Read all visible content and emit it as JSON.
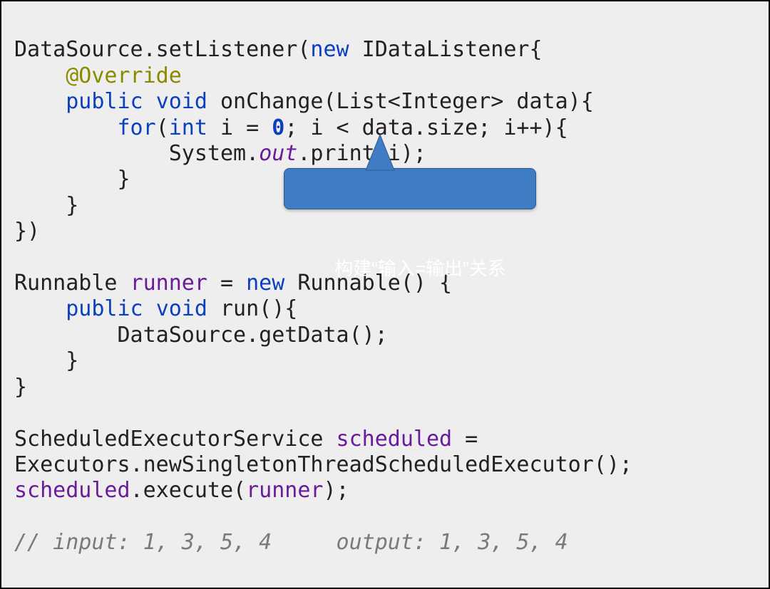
{
  "callout": {
    "text": "构建“输入=输出”关系"
  },
  "code": {
    "l1": {
      "a": "DataSource.setListener(",
      "b": "new",
      "c": " IDataListener{"
    },
    "l2": {
      "indent": "    ",
      "a": "@Override"
    },
    "l3": {
      "indent": "    ",
      "a": "public",
      "sp": " ",
      "b": "void",
      "c": " onChange(List<Integer> data){"
    },
    "l4": {
      "indent": "        ",
      "a": "for",
      "b": "(",
      "c": "int",
      "d": " i = ",
      "e": "0",
      "f": "; i < data.size; i++){"
    },
    "l5": {
      "indent": "            ",
      "a": "System.",
      "b": "out",
      "c": ".print(i);"
    },
    "l6": {
      "indent": "        ",
      "a": "}"
    },
    "l7": {
      "indent": "    ",
      "a": "}"
    },
    "l8": {
      "a": "})"
    },
    "blank1": "",
    "l9": {
      "a": "Runnable ",
      "b": "runner",
      "c": " = ",
      "d": "new",
      "e": " Runnable() {"
    },
    "l10": {
      "indent": "    ",
      "a": "public",
      "sp": " ",
      "b": "void",
      "c": " run(){"
    },
    "l11": {
      "indent": "        ",
      "a": "DataSource.getData();"
    },
    "l12": {
      "indent": "    ",
      "a": "}"
    },
    "l13": {
      "a": "}"
    },
    "blank2": "",
    "l14": {
      "a": "ScheduledExecutorService ",
      "b": "scheduled",
      "c": " ="
    },
    "l15": {
      "a": "Executors.newSingletonThreadScheduledExecutor();"
    },
    "l16": {
      "a": "scheduled",
      "b": ".execute(",
      "c": "runner",
      "d": ");"
    },
    "blank3": "",
    "l17": {
      "a": "// input: 1, 3, 5, 4     output: 1, 3, 5, 4"
    }
  }
}
